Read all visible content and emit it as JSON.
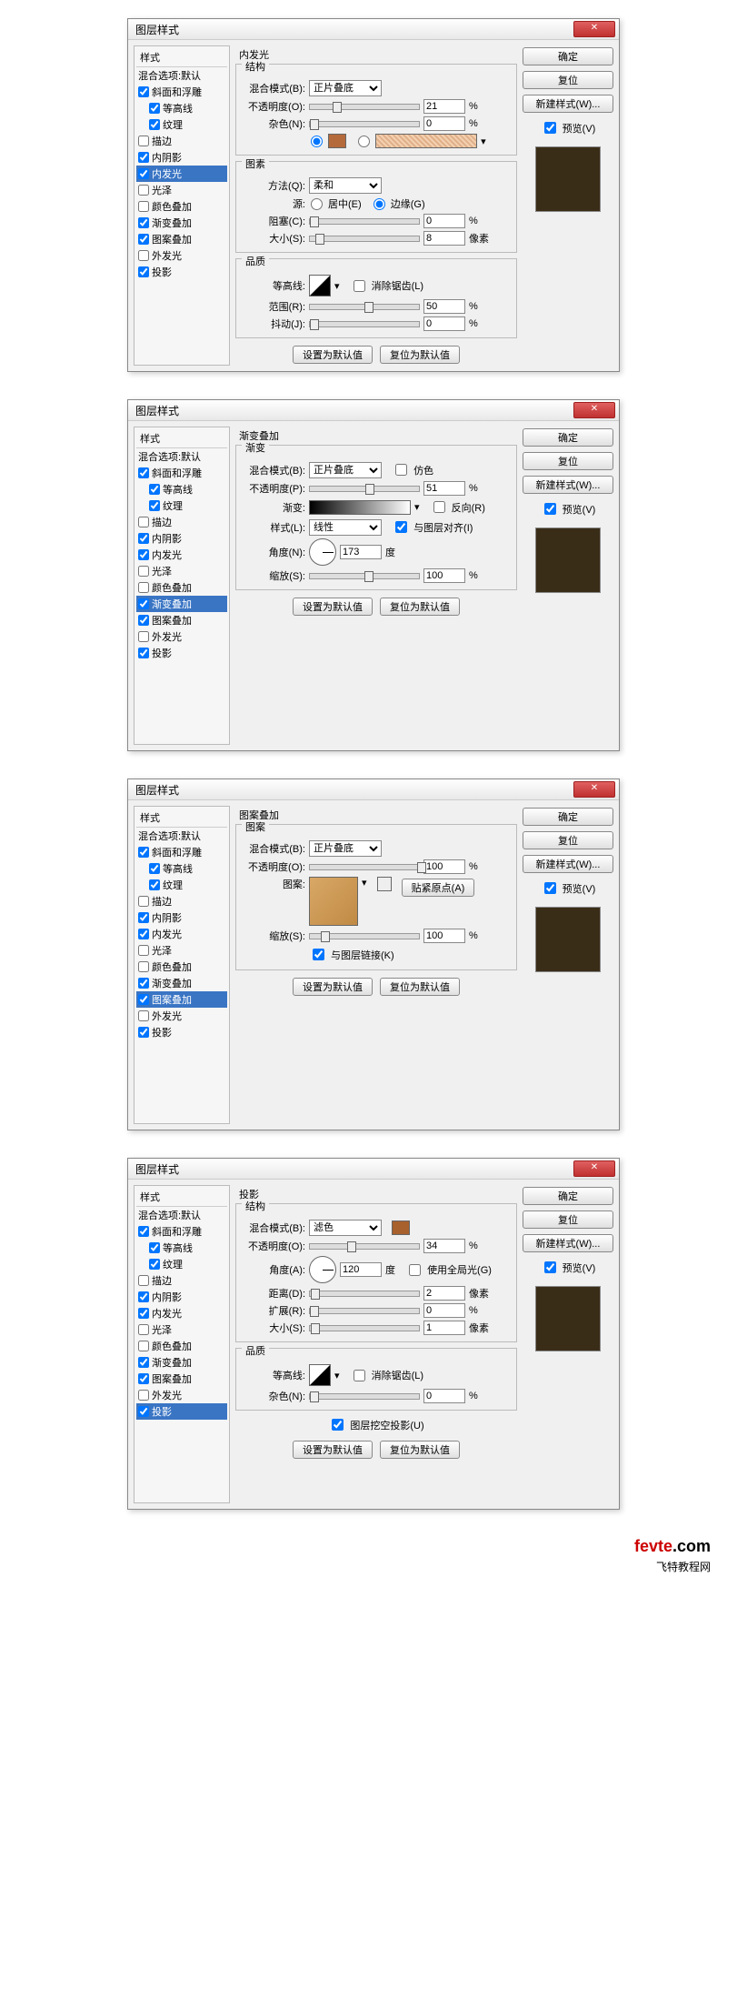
{
  "dialog_title": "图层样式",
  "close_glyph": "✕",
  "styles_header": "样式",
  "blending_options": "混合选项:默认",
  "style_names": {
    "bevel": "斜面和浮雕",
    "contour": "等高线",
    "texture": "纹理",
    "stroke": "描边",
    "inner_shadow": "内阴影",
    "inner_glow": "内发光",
    "satin": "光泽",
    "color_overlay": "颜色叠加",
    "gradient_overlay": "渐变叠加",
    "pattern_overlay": "图案叠加",
    "outer_glow": "外发光",
    "drop_shadow": "投影"
  },
  "buttons": {
    "ok": "确定",
    "cancel": "复位",
    "new_style": "新建样式(W)...",
    "preview": "预览(V)",
    "make_default": "设置为默认值",
    "reset_default": "复位为默认值",
    "snap_origin": "贴紧原点(A)"
  },
  "labels": {
    "structure": "结构",
    "elements": "图素",
    "quality": "品质",
    "gradient_grp": "渐变",
    "pattern_grp": "图案",
    "blend_mode": "混合模式(B):",
    "opacity": "不透明度(O):",
    "opacity_p": "不透明度(P):",
    "noise": "杂色(N):",
    "technique": "方法(Q):",
    "source": "源:",
    "center": "居中(E)",
    "edge": "边缘(G)",
    "choke": "阻塞(C):",
    "size": "大小(S):",
    "contour_l": "等高线:",
    "anti_alias": "消除锯齿(L)",
    "range": "范围(R):",
    "jitter": "抖动(J):",
    "gradient_l": "渐变:",
    "reverse": "反向(R)",
    "style_l": "样式(L):",
    "align_layer": "与图层对齐(I)",
    "angle": "角度(N):",
    "angle_a": "角度(A):",
    "degree": "度",
    "scale": "缩放(S):",
    "dither": "仿色",
    "pattern_l": "图案:",
    "link_layer": "与图层链接(K)",
    "distance": "距离(D):",
    "spread": "扩展(R):",
    "use_global": "使用全局光(G)",
    "knockout": "图层挖空投影(U)",
    "px": "像素",
    "pct": "%"
  },
  "blend_modes": {
    "multiply": "正片叠底",
    "screen": "滤色",
    "linear": "线性",
    "soft": "柔和"
  },
  "dialog1": {
    "panel_title": "内发光",
    "opacity": "21",
    "noise": "0",
    "choke": "0",
    "size": "8",
    "range": "50",
    "jitter": "0",
    "color": "#b56a3c",
    "noise_bg": "noise-sw"
  },
  "dialog2": {
    "panel_title": "渐变叠加",
    "opacity": "51",
    "angle": "173",
    "scale": "100"
  },
  "dialog3": {
    "panel_title": "图案叠加",
    "opacity": "100",
    "scale": "100"
  },
  "dialog4": {
    "panel_title": "投影",
    "opacity": "34",
    "angle": "120",
    "distance": "2",
    "spread": "0",
    "size": "1",
    "noise": "0",
    "color": "#a8602c"
  },
  "footer": {
    "a": "fevte",
    "b": ".com",
    "c": "飞特教程网"
  }
}
